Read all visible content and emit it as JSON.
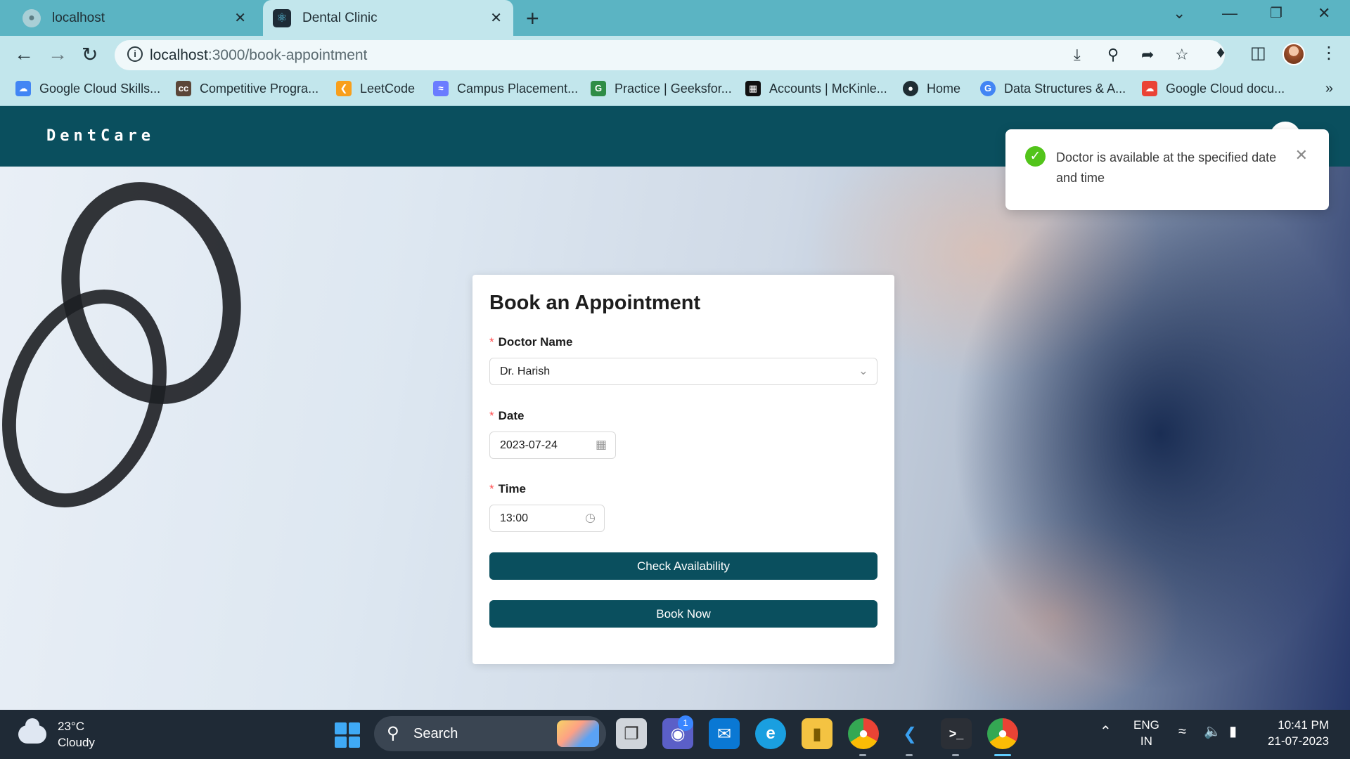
{
  "browser": {
    "tabs": [
      {
        "title": "localhost",
        "active": false
      },
      {
        "title": "Dental Clinic",
        "active": true
      }
    ],
    "url_host": "localhost",
    "url_path": ":3000/book-appointment",
    "bookmarks": [
      {
        "label": "Google Cloud Skills...",
        "icon": "google-cloud-icon",
        "color": "#4285f4"
      },
      {
        "label": "Competitive Progra...",
        "icon": "cc-icon",
        "color": "#5b4638"
      },
      {
        "label": "LeetCode",
        "icon": "leetcode-icon",
        "color": "#f89f1b"
      },
      {
        "label": "Campus Placement...",
        "icon": "campus-icon",
        "color": "#6b7cff"
      },
      {
        "label": "Practice | Geeksfor...",
        "icon": "gfg-icon",
        "color": "#2f8d46"
      },
      {
        "label": "Accounts | McKinle...",
        "icon": "mckinley-icon",
        "color": "#111111"
      },
      {
        "label": "Home",
        "icon": "globe-icon",
        "color": "#1f2d33"
      },
      {
        "label": "Data Structures & A...",
        "icon": "google-icon",
        "color": "#4285f4"
      },
      {
        "label": "Google Cloud docu...",
        "icon": "google-cloud-icon",
        "color": "#ea4335"
      }
    ]
  },
  "app": {
    "brand": "DentCare",
    "form": {
      "title": "Book an Appointment",
      "doctor_label": "Doctor Name",
      "doctor_value": "Dr. Harish",
      "date_label": "Date",
      "date_value": "2023-07-24",
      "time_label": "Time",
      "time_value": "13:00",
      "check_button": "Check Availability",
      "book_button": "Book Now"
    },
    "toast": {
      "message": "Doctor is available at the specified date and time",
      "type": "success"
    }
  },
  "taskbar": {
    "weather_temp": "23°C",
    "weather_desc": "Cloudy",
    "search_label": "Search",
    "teams_badge": "1",
    "lang_1": "ENG",
    "lang_2": "IN",
    "time": "10:41 PM",
    "date": "21-07-2023"
  },
  "colors": {
    "primary": "#0a4f5e",
    "chrome": "#5bb4c3",
    "success": "#52c41a",
    "required": "#ff4d4f"
  }
}
